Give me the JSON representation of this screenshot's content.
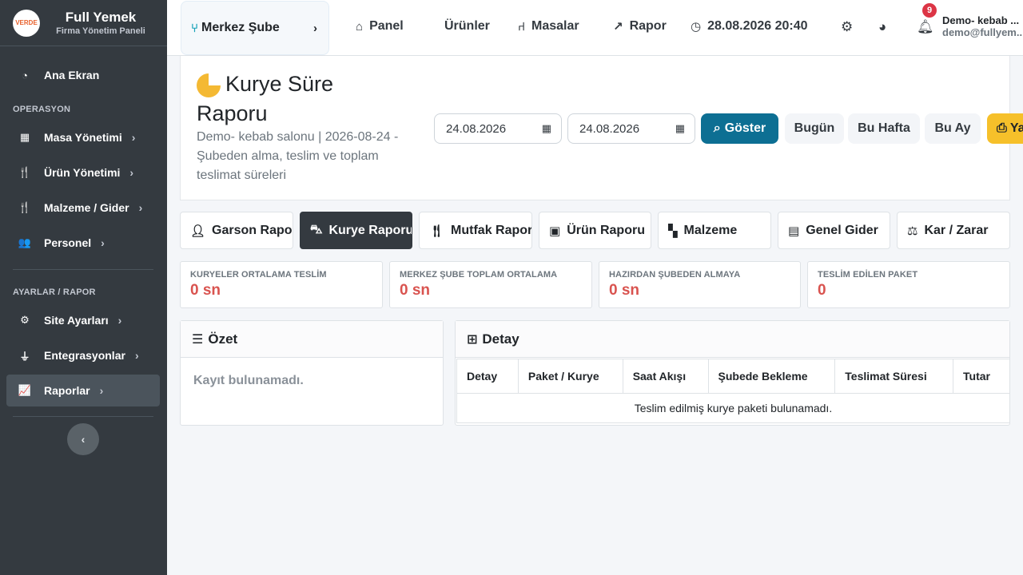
{
  "brand": {
    "logo_text": "VERDE",
    "title": "Full Yemek",
    "subtitle": "Firma Yönetim Paneli"
  },
  "sidebar": {
    "items": [
      {
        "label": "Ana Ekran",
        "icon": "gauge-icon"
      },
      {
        "label": "Masa Yönetimi",
        "icon": "grid-icon"
      },
      {
        "label": "Ürün Yönetimi",
        "icon": "utensils-icon"
      },
      {
        "label": "Malzeme / Gider",
        "icon": "utensils-icon"
      },
      {
        "label": "Personel",
        "icon": "users-icon"
      },
      {
        "label": "Site Ayarları",
        "icon": "gear-icon"
      },
      {
        "label": "Entegrasyonlar",
        "icon": "plug-icon"
      },
      {
        "label": "Raporlar",
        "icon": "chart-line-icon"
      }
    ],
    "section_operations": "OPERASYON",
    "section_settings": "AYARLAR / RAPOR",
    "active_color": "#4b545c"
  },
  "topbar": {
    "branch": "Merkez Şube",
    "links": {
      "panel": "Panel",
      "products": "Ürünler",
      "tables": "Masalar",
      "report": "Rapor"
    },
    "datetime": "28.08.2026 20:40",
    "notification_count": "9",
    "user_name": "Demo- kebab ...",
    "user_email": "demo@fullyem..."
  },
  "report": {
    "title_line1": "Kurye Süre",
    "title_line2": "Raporu",
    "subtitle": "Demo- kebab salonu | 2026-08-24 - Şubeden alma, teslim ve toplam teslimat süreleri",
    "date_from": "24.08.2026",
    "date_to": "24.08.2026",
    "show_button": "Göster",
    "today_button": "Bugün",
    "week_button": "Bu Hafta",
    "month_button": "Bu Ay",
    "print_button": "Yazdır",
    "primary_color": "#0d6f93",
    "print_color": "#f6c02a"
  },
  "tabs": [
    {
      "label": "Garson Raporu"
    },
    {
      "label": "Kurye Raporu"
    },
    {
      "label": "Mutfak Raporu"
    },
    {
      "label": "Ürün Raporu"
    },
    {
      "label": "Malzeme"
    },
    {
      "label": "Genel Gider"
    },
    {
      "label": "Kar / Zarar"
    }
  ],
  "stats": [
    {
      "label": "KURYELER ORTALAMA TESLİM",
      "value": "0 sn"
    },
    {
      "label": "MERKEZ ŞUBE TOPLAM ORTALAMA",
      "value": "0 sn"
    },
    {
      "label": "HAZIRDAN ŞUBEDEN ALMAYA",
      "value": "0 sn"
    },
    {
      "label": "TESLİM EDİLEN PAKET",
      "value": "0"
    }
  ],
  "summary": {
    "title": "Özet",
    "empty": "Kayıt bulunamadı."
  },
  "detail": {
    "title": "Detay",
    "columns": [
      "Detay",
      "Paket / Kurye",
      "Saat Akışı",
      "Şubede Bekleme",
      "Teslimat Süresi",
      "Tutar"
    ],
    "empty": "Teslim edilmiş kurye paketi bulunamadı."
  }
}
